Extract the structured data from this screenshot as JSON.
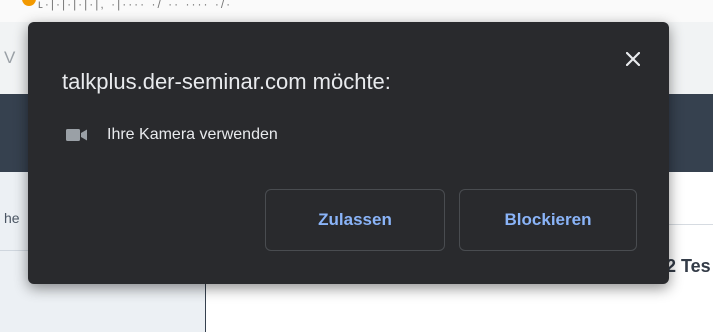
{
  "background": {
    "url_fragment": "ʟ·|·|·|·|·|, ·|···· ·/ ·· ···· ·/·",
    "tab_letter": "V",
    "side_text": "he",
    "main_text": "2 Tes"
  },
  "permission_popup": {
    "title": "talkplus.der-seminar.com möchte:",
    "permission": {
      "icon": "camera-icon",
      "label": "Ihre Kamera verwenden"
    },
    "buttons": {
      "allow_label": "Zulassen",
      "block_label": "Blockieren"
    },
    "close_icon": "close-icon"
  },
  "colors": {
    "popup_bg": "#292a2d",
    "accent_text": "#8ab4f8",
    "primary_text": "#e8eaed",
    "page_header": "#36414f"
  }
}
